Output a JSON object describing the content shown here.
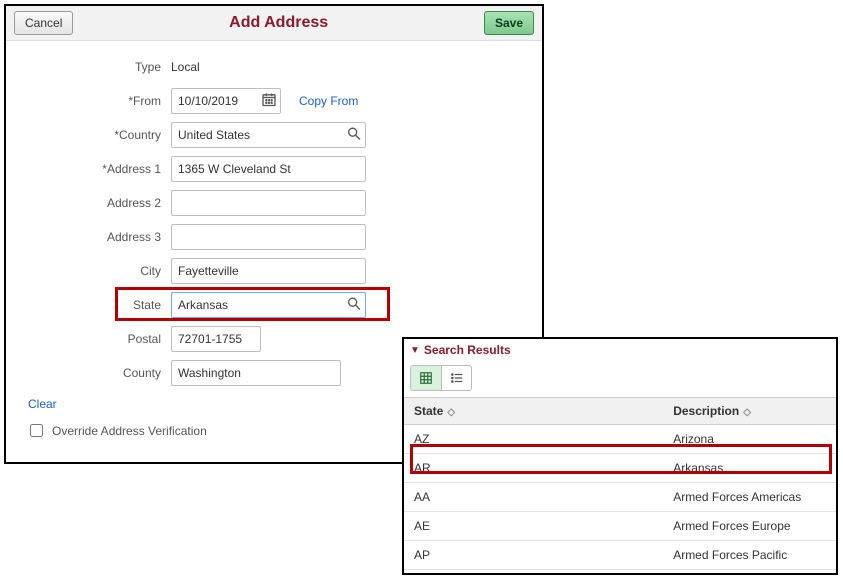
{
  "header": {
    "title": "Add Address",
    "cancel_label": "Cancel",
    "save_label": "Save"
  },
  "form": {
    "type_label": "Type",
    "type_value": "Local",
    "from_label": "*From",
    "from_value": "10/10/2019",
    "copy_from_label": "Copy From",
    "country_label": "*Country",
    "country_value": "United States",
    "address1_label": "*Address 1",
    "address1_value": "1365 W Cleveland St",
    "address2_label": "Address 2",
    "address2_value": "",
    "address3_label": "Address 3",
    "address3_value": "",
    "city_label": "City",
    "city_value": "Fayetteville",
    "state_label": "State",
    "state_value": "Arkansas",
    "postal_label": "Postal",
    "postal_value": "72701-1755",
    "county_label": "County",
    "county_value": "Washington",
    "clear_label": "Clear",
    "override_label": "Override Address Verification"
  },
  "results": {
    "title": "Search Results",
    "col_state": "State",
    "col_desc": "Description",
    "rows": [
      {
        "code": "AZ",
        "desc": "Arizona"
      },
      {
        "code": "AR",
        "desc": "Arkansas"
      },
      {
        "code": "AA",
        "desc": "Armed Forces Americas"
      },
      {
        "code": "AE",
        "desc": "Armed Forces Europe"
      },
      {
        "code": "AP",
        "desc": "Armed Forces Pacific"
      }
    ]
  }
}
